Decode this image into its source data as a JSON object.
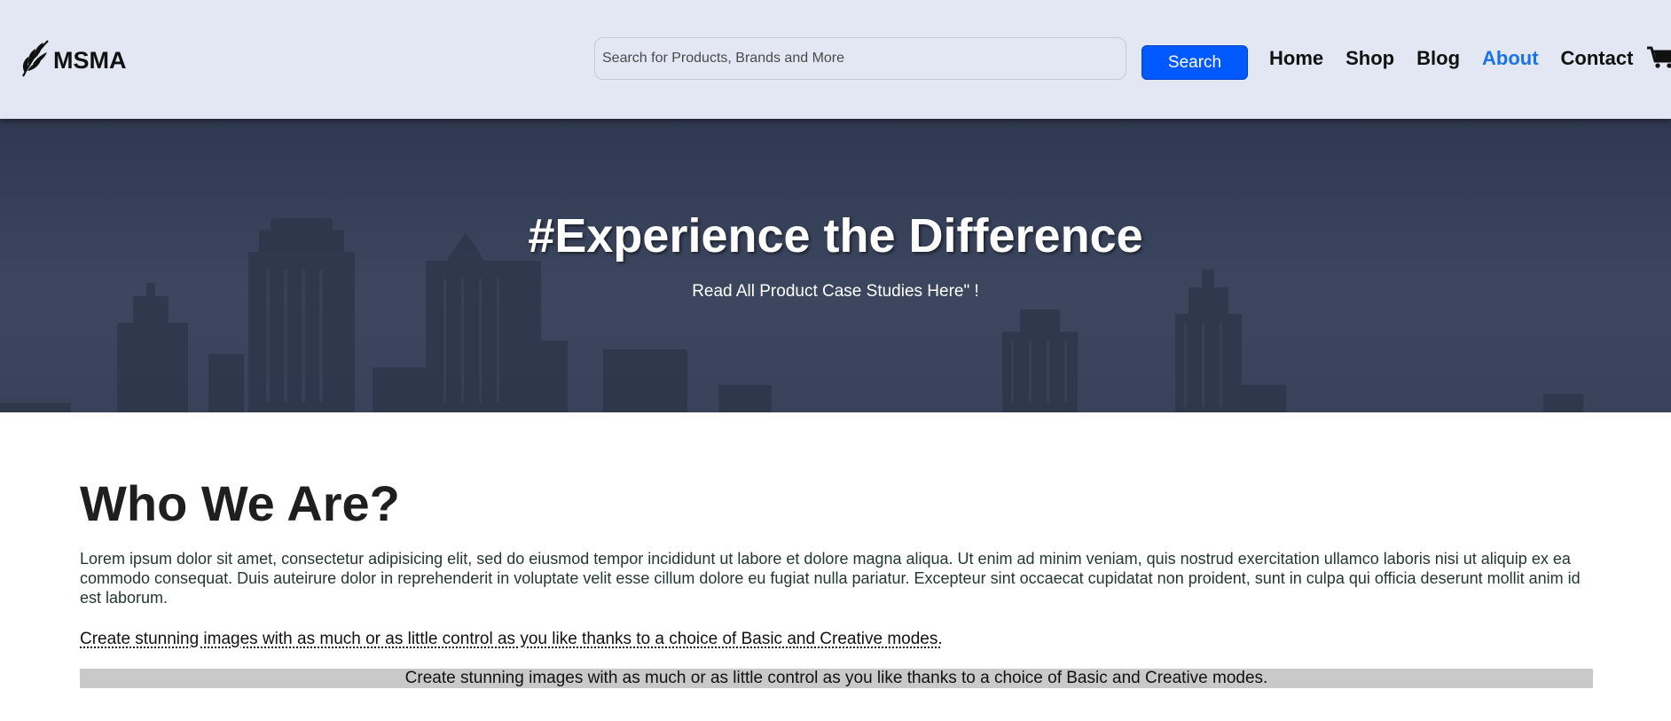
{
  "header": {
    "logo_text": "MSMA",
    "logo_icon": "feather-leaf-icon",
    "search": {
      "placeholder": "Search for Products, Brands and More",
      "value": ""
    },
    "search_button_label": "Search",
    "nav": [
      {
        "label": "Home",
        "active": false
      },
      {
        "label": "Shop",
        "active": false
      },
      {
        "label": "Blog",
        "active": false
      },
      {
        "label": "About",
        "active": true
      },
      {
        "label": "Contact",
        "active": false
      }
    ],
    "cart_icon": "shopping-cart-icon"
  },
  "hero": {
    "title": "#Experience the Difference",
    "subtitle": "Read All Product Case Studies Here\" !"
  },
  "about": {
    "title": "Who We Are?",
    "text": "Lorem ipsum dolor sit amet, consectetur adipisicing elit, sed do eiusmod tempor incididunt ut labore et dolore magna aliqua. Ut enim ad minim veniam, quis nostrud exercitation ullamco laboris nisi ut aliquip ex ea commodo consequat. Duis auteirure dolor in reprehenderit in voluptate velit esse cillum dolore eu fugiat nulla pariatur. Excepteur sint occaecat cupidatat non proident, sunt in culpa qui officia deserunt mollit anim id est laborum.",
    "link_text": "Create stunning images with as much or as little control as you like thanks to a choice of Basic and Creative modes.",
    "highlight_text": "Create stunning images with as much or as little control as you like thanks to a choice of Basic and Creative modes."
  },
  "colors": {
    "header_bg": "#e3e6f3",
    "accent": "#0059ff",
    "active_nav": "#1a73e8",
    "hero_bg": "#3a455e",
    "highlight_bg": "#c9c9c9"
  }
}
